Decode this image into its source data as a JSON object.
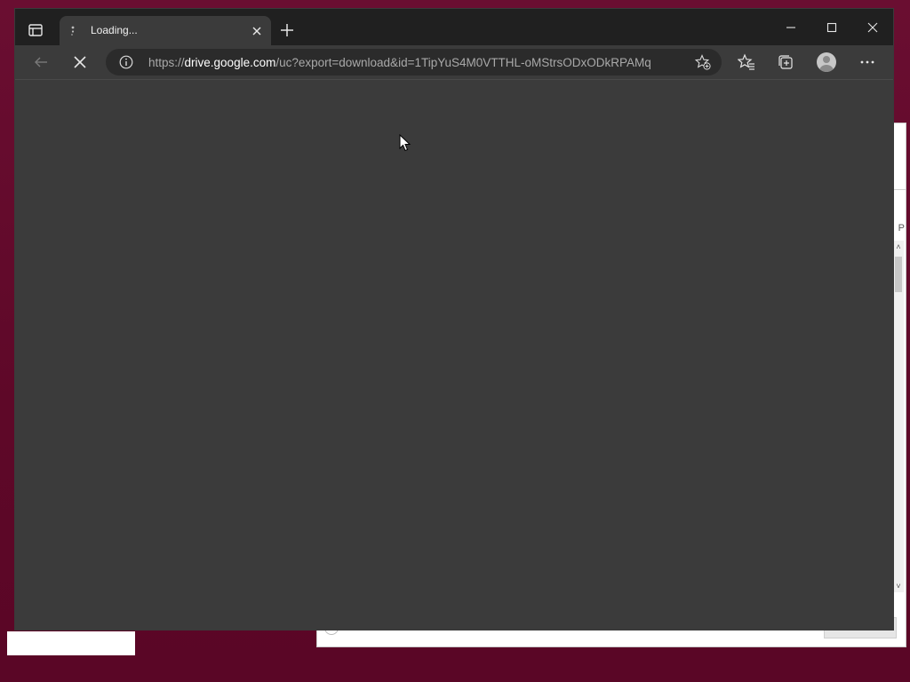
{
  "browser": {
    "tab": {
      "title": "Loading..."
    },
    "address_bar": {
      "scheme": "https://",
      "host": "drive.google.com",
      "path": "/uc?export=download&id=1TipYuS4M0VTTHL-oMStrsODxODkRPAMq"
    },
    "state": "loading"
  },
  "background_window": {
    "partial_letter": "P"
  },
  "colors": {
    "desktop": "#610a2c",
    "titlebar": "#202020",
    "toolbar": "#3b3b3b",
    "address_bar": "#2b2b2b",
    "content": "#3b3b3b"
  },
  "icons": {
    "tab_actions": "tab-actions-icon",
    "loading": "loading-spinner-icon",
    "close_tab": "close-icon",
    "new_tab": "plus-icon",
    "minimize": "minimize-icon",
    "maximize": "maximize-icon",
    "close_window": "close-icon",
    "back": "back-arrow-icon",
    "stop": "stop-icon",
    "site_info": "info-icon",
    "add_favorite": "star-add-icon",
    "favorites": "favorites-icon",
    "collections": "collections-icon",
    "profile": "avatar-icon",
    "menu": "more-icon"
  }
}
